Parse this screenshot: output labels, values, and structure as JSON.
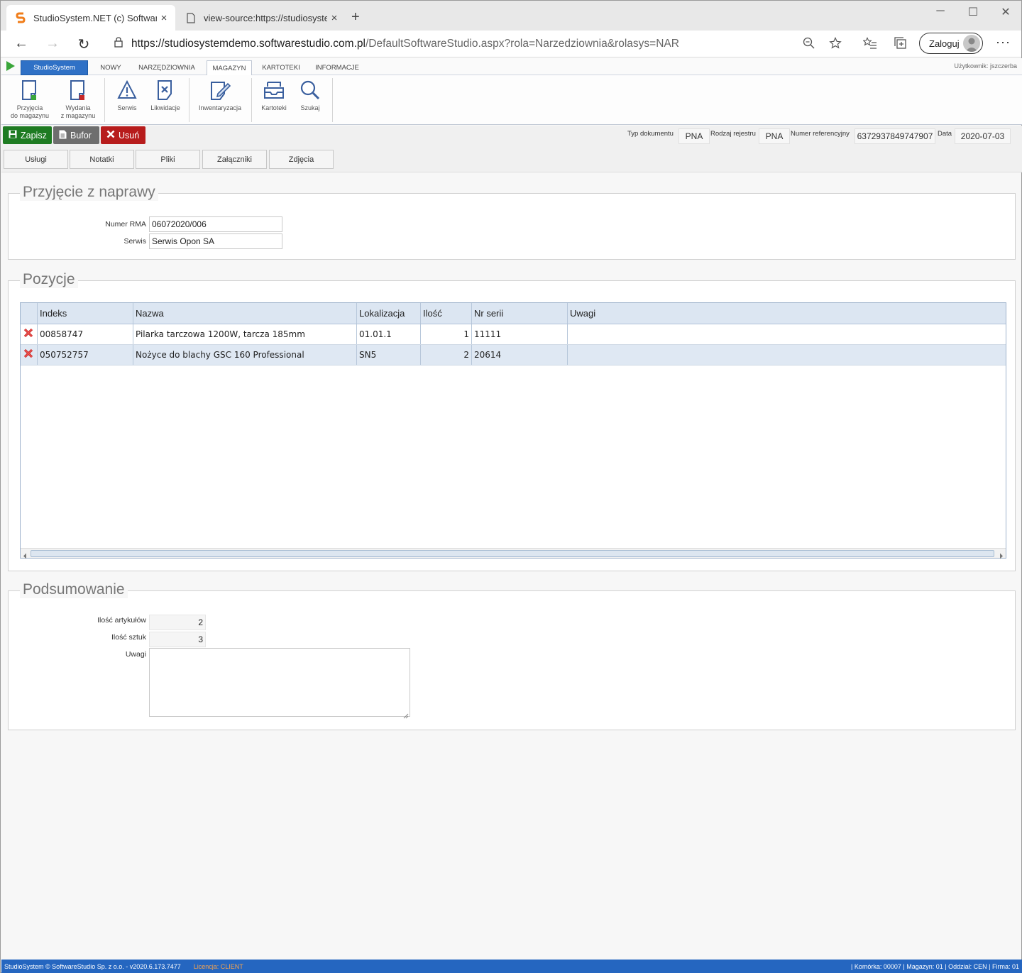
{
  "browser": {
    "tabs": [
      {
        "title": "StudioSystem.NET (c) SoftwareSt",
        "close": "×"
      },
      {
        "title": "view-source:https://studiosysten",
        "close": "×"
      }
    ],
    "new_tab": "+",
    "window_controls": {
      "minimize": "─",
      "maximize": "☐",
      "close": "✕"
    },
    "url_host": "https://studiosystemdemo.softwarestudio.com.pl",
    "url_path": "/DefaultSoftwareStudio.aspx?rola=Narzedziownia&rolasys=NAR",
    "signin_label": "Zaloguj",
    "more_label": "···"
  },
  "menu": {
    "brand": "StudioSystem",
    "tabs": [
      "NOWY",
      "NARZĘDZIOWNIA",
      "MAGAZYN",
      "KARTOTEKI",
      "INFORMACJE"
    ],
    "active_tab": "MAGAZYN",
    "user": "Użytkownik: jszczerba"
  },
  "ribbon": {
    "przyjecia_l1": "Przyjęcia",
    "przyjecia_l2": "do magazynu",
    "wydania_l1": "Wydania",
    "wydania_l2": "z magazynu",
    "serwis": "Serwis",
    "likwidacje": "Likwidacje",
    "inwentaryzacja": "Inwentaryzacja",
    "kartoteki": "Kartoteki",
    "szukaj": "Szukaj"
  },
  "actions": {
    "zapisz": "Zapisz",
    "bufor": "Bufor",
    "usun": "Usuń",
    "colors": {
      "zapisz": "#1e7b22",
      "bufor": "#6e6e6e",
      "usun": "#b71c1c"
    }
  },
  "doc_meta": {
    "typ_label": "Typ dokumentu",
    "typ_value": "PNA",
    "rodzaj_label": "Rodzaj rejestru",
    "rodzaj_value": "PNA",
    "numer_label": "Numer referencyjny",
    "numer_value": "6372937849747907",
    "data_label": "Data",
    "data_value": "2020-07-03"
  },
  "subtabs": [
    "Usługi",
    "Notatki",
    "Pliki",
    "Załączniki",
    "Zdjęcia"
  ],
  "przyjecie": {
    "legend": "Przyjęcie z naprawy",
    "rma_label": "Numer RMA",
    "rma_value": "06072020/006",
    "serwis_label": "Serwis",
    "serwis_value": "Serwis Opon SA"
  },
  "pozycje": {
    "legend": "Pozycje",
    "columns": [
      "Indeks",
      "Nazwa",
      "Lokalizacja",
      "Ilość",
      "Nr serii",
      "Uwagi"
    ],
    "rows": [
      {
        "indeks": "00858747",
        "nazwa": "Pilarka tarczowa 1200W, tarcza 185mm",
        "lokalizacja": "01.01.1",
        "ilosc": "1",
        "nr_serii": "11111",
        "uwagi": ""
      },
      {
        "indeks": "050752757",
        "nazwa": "Nożyce do blachy GSC 160 Professional",
        "lokalizacja": "SN5",
        "ilosc": "2",
        "nr_serii": "20614",
        "uwagi": ""
      }
    ]
  },
  "podsumowanie": {
    "legend": "Podsumowanie",
    "ilosc_art_label": "Ilość artykułów",
    "ilosc_art_value": "2",
    "ilosc_szt_label": "Ilość sztuk",
    "ilosc_szt_value": "3",
    "uwagi_label": "Uwagi",
    "uwagi_value": ""
  },
  "footer": {
    "copyright": "StudioSystem © SoftwareStudio Sp. z o.o. - v2020.6.173.7477",
    "licencja": "Licencja: CLIENT",
    "status": "| Komórka: 00007 | Magazyn: 01 | Oddział: CEN | Firma: 01"
  }
}
